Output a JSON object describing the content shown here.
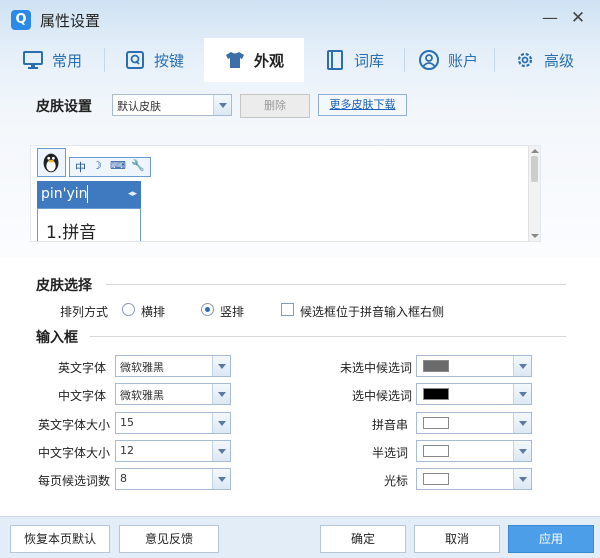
{
  "window": {
    "title": "属性设置",
    "logo_letter": "Q",
    "minimize": "—",
    "close": "✕"
  },
  "tabs": [
    {
      "label": "常用",
      "icon": "monitor-icon"
    },
    {
      "label": "按键",
      "icon": "key-q-icon"
    },
    {
      "label": "外观",
      "icon": "tshirt-icon",
      "active": true
    },
    {
      "label": "词库",
      "icon": "book-icon"
    },
    {
      "label": "账户",
      "icon": "user-icon"
    },
    {
      "label": "高级",
      "icon": "gear-icon"
    }
  ],
  "skin_settings": {
    "label": "皮肤设置",
    "selected": "默认皮肤",
    "delete_label": "删除",
    "more_label": "更多皮肤下载"
  },
  "preview": {
    "bar_items": [
      "中",
      "☽",
      "⌨",
      "🔧"
    ],
    "input_text": "pin'yin",
    "nav": "◂▸",
    "candidate": "1.拼音"
  },
  "skin_choice": {
    "label": "皮肤选择",
    "layout_label": "排列方式",
    "horizontal_label": "横排",
    "vertical_label": "竖排",
    "vertical_selected": true,
    "candidate_right_label": "候选框位于拼音输入框右侧",
    "candidate_right_checked": false
  },
  "input_box": {
    "label": "输入框",
    "left_fields": [
      {
        "label": "英文字体",
        "value": "微软雅黑"
      },
      {
        "label": "中文字体",
        "value": "微软雅黑"
      },
      {
        "label": "英文字体大小",
        "value": "15"
      },
      {
        "label": "中文字体大小",
        "value": "12"
      },
      {
        "label": "每页候选词数",
        "value": "8"
      }
    ],
    "right_fields": [
      {
        "label": "未选中候选词",
        "color": "#6b6b6b"
      },
      {
        "label": "选中候选词",
        "color": "#000000"
      },
      {
        "label": "拼音串",
        "color": "#ffffff"
      },
      {
        "label": "半选词",
        "color": "#ffffff"
      },
      {
        "label": "光标",
        "color": "#ffffff"
      }
    ]
  },
  "footer": {
    "restore_label": "恢复本页默认",
    "feedback_label": "意见反馈",
    "ok_label": "确定",
    "cancel_label": "取消",
    "apply_label": "应用"
  },
  "colors": {
    "accent": "#2a6fb0",
    "apply": "#4d9ee8"
  }
}
